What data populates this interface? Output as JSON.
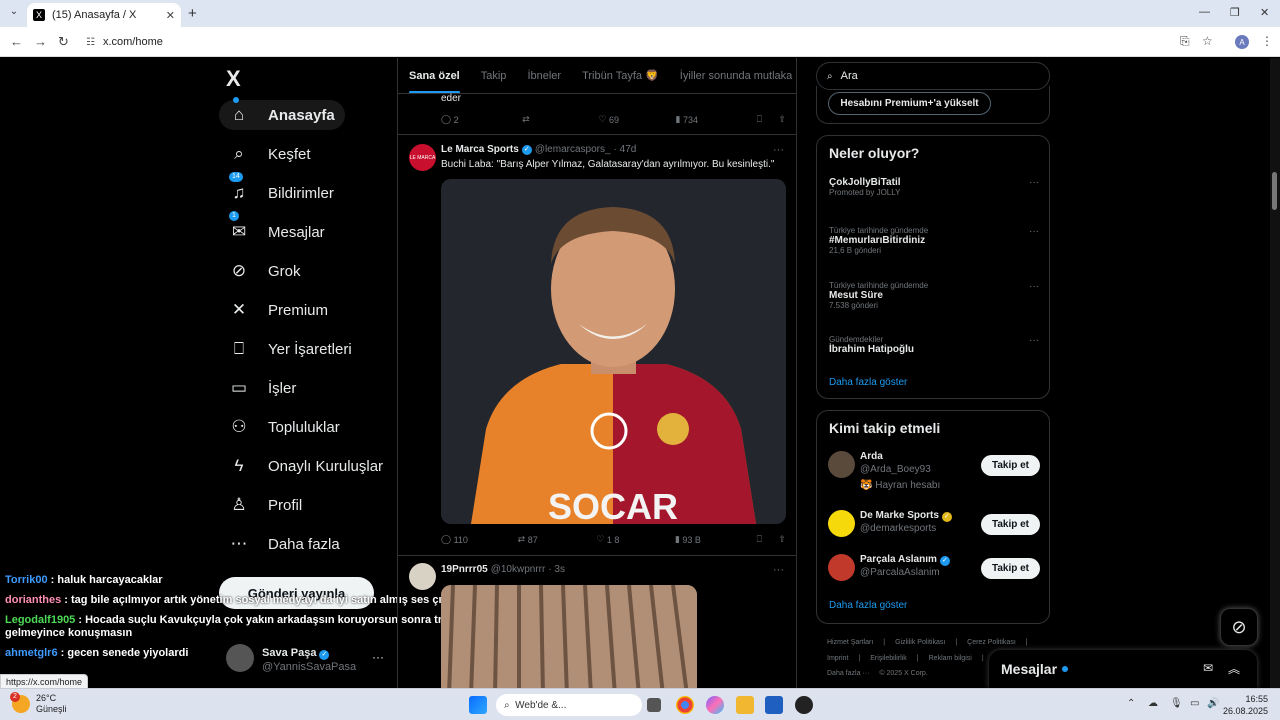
{
  "browser": {
    "tab_title": "(15) Anasayfa / X",
    "tab_favicon": "X",
    "url": "x.com/home",
    "status_url": "https://x.com/home",
    "profile_initial": "A"
  },
  "sidebar": {
    "logo": "X",
    "items": [
      {
        "label": "Anasayfa",
        "icon": "home-icon",
        "glyph": "⌂",
        "active": true,
        "dot": true
      },
      {
        "label": "Keşfet",
        "icon": "search-icon",
        "glyph": "⌕"
      },
      {
        "label": "Bildirimler",
        "icon": "bell-icon",
        "glyph": "♫",
        "badge": "14"
      },
      {
        "label": "Mesajlar",
        "icon": "mail-icon",
        "glyph": "✉",
        "badge": "1"
      },
      {
        "label": "Grok",
        "icon": "grok-icon",
        "glyph": "⊘"
      },
      {
        "label": "Premium",
        "icon": "x-premium-icon",
        "glyph": "✕"
      },
      {
        "label": "Yer İşaretleri",
        "icon": "bookmark-icon",
        "glyph": "⎕"
      },
      {
        "label": "İşler",
        "icon": "briefcase-icon",
        "glyph": "▭"
      },
      {
        "label": "Topluluklar",
        "icon": "people-icon",
        "glyph": "⚇"
      },
      {
        "label": "Onaylı Kuruluşlar",
        "icon": "lightning-icon",
        "glyph": "ϟ"
      },
      {
        "label": "Profil",
        "icon": "person-icon",
        "glyph": "♙"
      },
      {
        "label": "Daha fazla",
        "icon": "more-circle-icon",
        "glyph": "⋯"
      }
    ],
    "post_button": "Gönderi yayınla",
    "profile_name": "Sava Paşa",
    "profile_handle": "@YannisSavaPasa"
  },
  "chat_overlay": [
    {
      "user": "Torrik00",
      "color": "#3d9bff",
      "text": " : haluk harcayacaklar"
    },
    {
      "user": "dorianthes",
      "color": "#ff8fb1",
      "text": " : tag bile açılmıyor artık yönetim sosyal medyayı da iyi satın almış ses çıkmıyor artık"
    },
    {
      "user": "Legodalf1905",
      "color": "#4cdb55",
      "text": " : Hocada suçlu Kavukçuyla çok yakın arkadaşsın koruyorsun sonra transfer"
    },
    {
      "user": "",
      "color": "#ffffff",
      "text": "gelmeyince konuşmasın"
    },
    {
      "user": "ahmetglr6",
      "color": "#3d9bff",
      "text": " : gecen senede yiyolardi"
    }
  ],
  "timeline": {
    "tabs": [
      "Sana özel",
      "Takip",
      "İbneler",
      "Tribün Tayfa 🦁",
      "İyiller sonunda mutlaka kazanır"
    ],
    "prev_tweet": {
      "text_tail": "eder",
      "replies": "2",
      "retweets": "",
      "likes": "69",
      "views": "734"
    },
    "tweet1": {
      "name": "Le Marca Sports",
      "handle": "@lemarcaspors_",
      "time": "· 47d",
      "text": "Buchi Laba: \"Barış Alper Yılmaz, Galatasaray'dan ayrılmıyor. Bu kesinleşti.\"",
      "replies": "110",
      "retweets": "87",
      "likes": "1 8",
      "views": "93 B",
      "media_text": "SOCAR"
    },
    "tweet2": {
      "name": "19Pnrrr05",
      "handle": "@10kwpnrrr",
      "time": "· 3s"
    }
  },
  "right": {
    "search_placeholder": "Ara",
    "premium_button": "Hesabını Premium+'a yükselt",
    "trends_title": "Neler oluyor?",
    "trends": [
      {
        "ctx": "",
        "name": "ÇokJollyBiTatil",
        "cnt": "Promoted by JOLLY"
      },
      {
        "ctx": "Türkiye tarihinde gündemde",
        "name": "#MemurlarıBitirdiniz",
        "cnt": "21,6 B gönderi"
      },
      {
        "ctx": "Türkiye tarihinde gündemde",
        "name": "Mesut Süre",
        "cnt": "7.538 gönderi"
      },
      {
        "ctx": "Gündemdekiler",
        "name": "İbrahim Hatipoğlu",
        "cnt": ""
      }
    ],
    "show_more": "Daha fazla göster",
    "who_title": "Kimi takip etmeli",
    "who": [
      {
        "name": "Arda",
        "handle": "@Arda_Boey93",
        "extra": "🐯 Hayran hesabı",
        "verified": "",
        "follow": "Takip et"
      },
      {
        "name": "De Marke Sports",
        "handle": "@demarkesports",
        "extra": "",
        "verified": "gold",
        "follow": "Takip et"
      },
      {
        "name": "Parçala Aslanım",
        "handle": "@ParcalaAslanim",
        "extra": "",
        "verified": "blue",
        "follow": "Takip et"
      }
    ],
    "who_show_more": "Daha fazla göster",
    "footer_line1": [
      "Hizmet Şartları",
      "|",
      "Gizlilik Politikası",
      "|",
      "Çerez Politikası",
      "|"
    ],
    "footer_line2": [
      "Imprint",
      "|",
      "Erişilebilirlik",
      "|",
      "Reklam bilgisi",
      "|"
    ],
    "footer_line3": [
      "Daha fazla ···",
      "© 2025 X Corp."
    ]
  },
  "messages_drawer": {
    "title": "Mesajlar"
  },
  "taskbar": {
    "temp": "26°C",
    "weather": "Güneşli",
    "weather_badge": "2",
    "search_text": "Web'de &...",
    "time": "16:55",
    "date": "26.08.2025"
  },
  "colors": {
    "accent": "#1d9bf0",
    "gold": "#e2b719",
    "bg": "#000000",
    "text": "#e7e9ea",
    "muted": "#71767b"
  }
}
